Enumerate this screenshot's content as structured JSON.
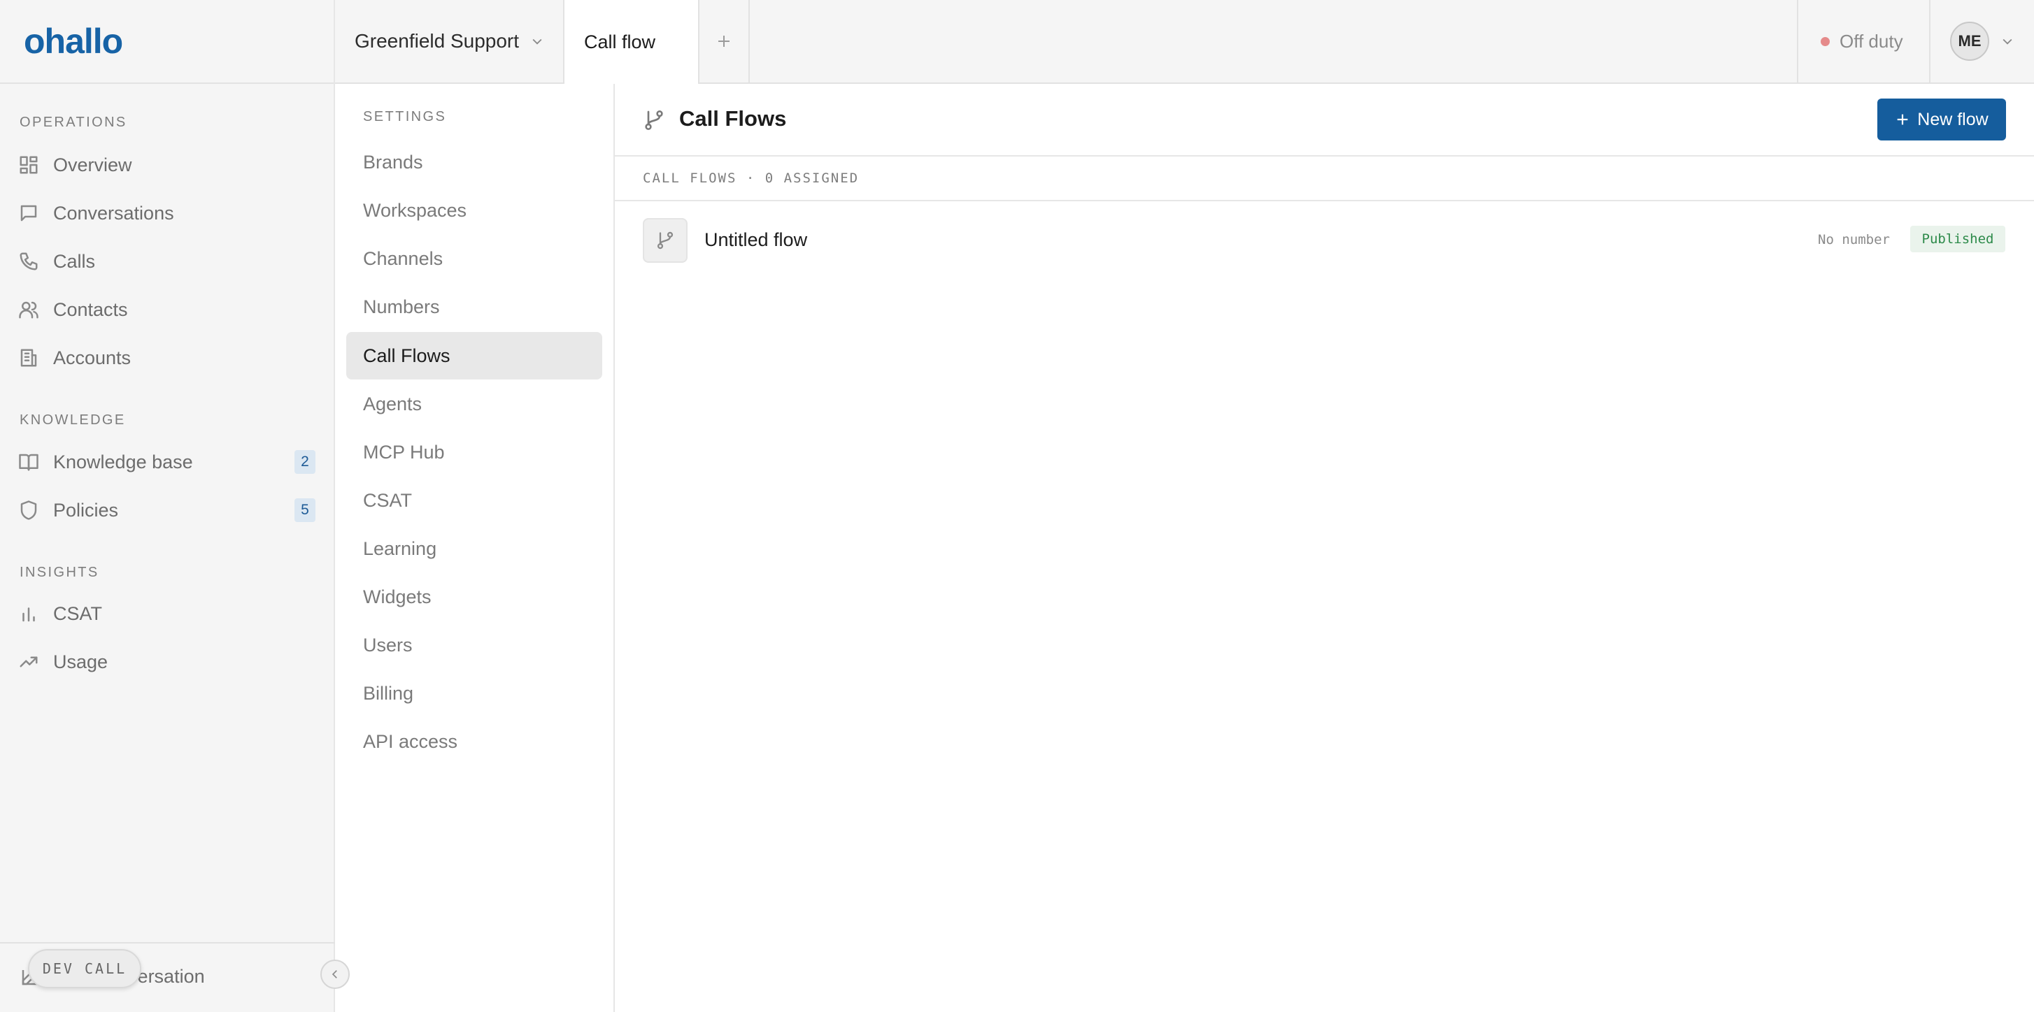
{
  "brand": {
    "logo_text": "ohallo",
    "accent": "#1763a6"
  },
  "sidebar": {
    "sections": [
      {
        "label": "OPERATIONS"
      },
      {
        "label": "KNOWLEDGE"
      },
      {
        "label": "INSIGHTS"
      }
    ],
    "items": [
      {
        "label": "Overview",
        "icon": "grid-icon"
      },
      {
        "label": "Conversations",
        "icon": "chat-icon"
      },
      {
        "label": "Calls",
        "icon": "phone-icon"
      },
      {
        "label": "Contacts",
        "icon": "users-icon"
      },
      {
        "label": "Accounts",
        "icon": "building-icon"
      },
      {
        "label": "Knowledge base",
        "icon": "book-icon",
        "badge": "2"
      },
      {
        "label": "Policies",
        "icon": "shield-icon",
        "badge": "5"
      },
      {
        "label": "CSAT",
        "icon": "bar-chart-icon"
      },
      {
        "label": "Usage",
        "icon": "trend-icon"
      }
    ],
    "footer": {
      "new_conversation_label": "New conversation",
      "dev_call_label": "DEV CALL"
    }
  },
  "topbar": {
    "workspace": "Greenfield Support",
    "active_tab": "Call flow",
    "status": "Off duty",
    "status_color": "#e58a8a",
    "avatar_initials": "ME"
  },
  "settings": {
    "title": "SETTINGS",
    "items": [
      "Brands",
      "Workspaces",
      "Channels",
      "Numbers",
      "Call Flows",
      "Agents",
      "MCP Hub",
      "CSAT",
      "Learning",
      "Widgets",
      "Users",
      "Billing",
      "API access"
    ],
    "active": "Call Flows"
  },
  "main": {
    "title": "Call Flows",
    "new_button": "New flow",
    "button_color": "#155d9d",
    "list_header": "CALL FLOWS · 0 ASSIGNED",
    "flows": [
      {
        "name": "Untitled flow",
        "number": "No number",
        "status": "Published",
        "status_color": "#2d8a4a"
      }
    ]
  }
}
